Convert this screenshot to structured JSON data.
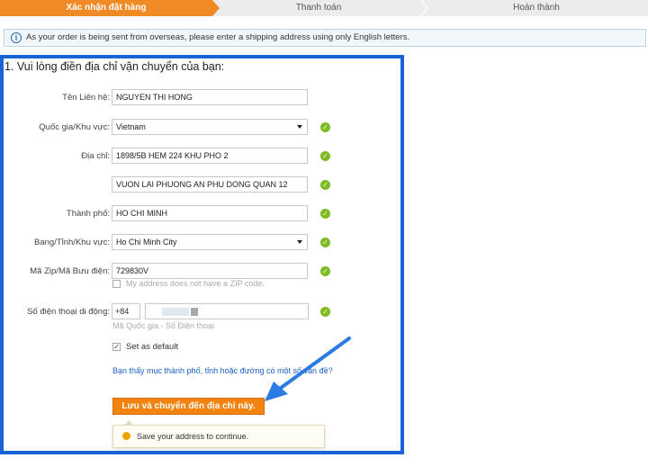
{
  "steps": [
    {
      "label": "Xác nhận đặt hàng",
      "active": true
    },
    {
      "label": "Thanh toán",
      "active": false
    },
    {
      "label": "Hoàn thành",
      "active": false
    }
  ],
  "notice": "As your order is being sent from overseas, please enter a shipping address using only English letters.",
  "form": {
    "title": "1. Vui lòng điền địa chỉ vận chuyển của bạn:",
    "contact_label": "Tên Liên hệ:",
    "contact_value": "NGUYEN THI HONG",
    "country_label": "Quốc gia/Khu vực:",
    "country_value": "Vietnam",
    "address_label": "Địa chỉ:",
    "address1_value": "1898/5B HEM 224 KHU PHO 2",
    "address2_value": "VUON LAI PHUONG AN PHU DONG QUAN 12",
    "city_label": "Thành phố:",
    "city_value": "HO CHI MINH",
    "state_label": "Bang/Tỉnh/Khu vực:",
    "state_value": "Ho Chi Minh City",
    "zip_label": "Mã Zip/Mã Bưu điện:",
    "zip_value": "729830V",
    "no_zip_label": "My address does not have a ZIP code.",
    "phone_label": "Số điện thoại di động:",
    "phone_code": "+84",
    "phone_hint": "Mã Quốc gia - Số Điện thoại",
    "default_label": "Set as default",
    "help_link": "Bạn thấy mục thành phố, tỉnh hoặc đường có một số vấn đề?",
    "save_button": "Lưu và chuyển đến địa chỉ này.",
    "tip": "Save your address to continue."
  },
  "colors": {
    "accent": "#f08a24",
    "panel_border": "#1a62d8",
    "valid": "#7fba23",
    "link": "#1a62c6"
  }
}
